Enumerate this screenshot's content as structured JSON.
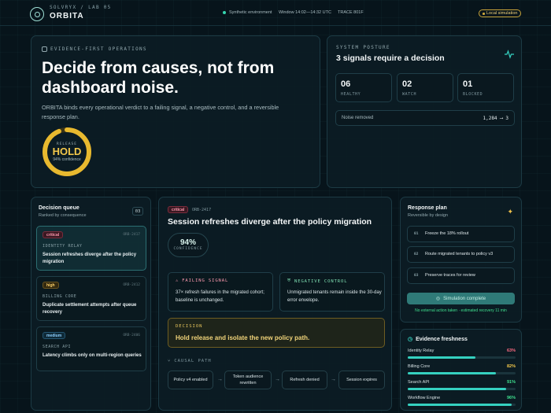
{
  "topbar": {
    "org": "SOLVRYX / LAB 05",
    "app": "ORBITA",
    "environment": "Synthetic environment",
    "window": "Window 14:02—14:32 UTC",
    "trace": "TRACE 801F",
    "simulation": "Local simulation"
  },
  "hero": {
    "kicker": "EVIDENCE-FIRST OPERATIONS",
    "title": "Decide from causes, not from dashboard noise.",
    "description": "ORBITA binds every operational verdict to a failing signal, a negative control, and a reversible response plan.",
    "gauge": {
      "label": "RELEASE",
      "value": "HOLD",
      "confidence": "94% confidence",
      "confidence_fraction": 0.94
    }
  },
  "posture": {
    "kicker": "SYSTEM POSTURE",
    "title": "3 signals require a decision",
    "stats": [
      {
        "value": "06",
        "label": "HEALTHY"
      },
      {
        "value": "02",
        "label": "WATCH"
      },
      {
        "value": "01",
        "label": "BLOCKED"
      }
    ],
    "noise": {
      "label": "Noise removed",
      "value": "1,284 ⟶ 3"
    }
  },
  "queue": {
    "title": "Decision queue",
    "subtitle": "Ranked by consequence",
    "count": "03",
    "items": [
      {
        "severity": "critical",
        "id": "ORB-2417",
        "service": "IDENTITY RELAY",
        "text": "Session refreshes diverge after the policy migration"
      },
      {
        "severity": "high",
        "id": "ORB-2412",
        "service": "BILLING CORE",
        "text": "Duplicate settlement attempts after queue recovery"
      },
      {
        "severity": "medium",
        "id": "ORB-2406",
        "service": "SEARCH API",
        "text": "Latency climbs only on multi-region queries"
      }
    ]
  },
  "detail": {
    "severity": "critical",
    "id": "ORB-2417",
    "title": "Session refreshes diverge after the policy migration",
    "confidence": "94%",
    "confidence_label": "CONFIDENCE",
    "failing_signal": {
      "heading": "FAILING SIGNAL",
      "text": "37× refresh failures in the migrated cohort; baseline is unchanged."
    },
    "negative_control": {
      "heading": "NEGATIVE CONTROL",
      "text": "Unmigrated tenants remain inside the 30-day error envelope."
    },
    "decision": {
      "heading": "DECISION",
      "text": "Hold release and isolate the new policy path."
    },
    "causal_heading": "CAUSAL PATH",
    "causal_path": [
      "Policy v4 enabled",
      "Token audience rewritten",
      "Refresh denied",
      "Session expires"
    ]
  },
  "plan": {
    "title": "Response plan",
    "subtitle": "Reversible by design",
    "steps": [
      {
        "n": "01",
        "text": "Freeze the 18% rollout"
      },
      {
        "n": "02",
        "text": "Route migrated tenants to policy v3"
      },
      {
        "n": "03",
        "text": "Preserve traces for review"
      }
    ],
    "button": "Simulation complete",
    "note": "No external action taken · estimated recovery 11 min"
  },
  "freshness": {
    "title": "Evidence freshness",
    "rows": [
      {
        "label": "Identity Relay",
        "percent": "63%",
        "value": 0.63,
        "color": "#ff6b82"
      },
      {
        "label": "Billing Core",
        "percent": "82%",
        "value": 0.82,
        "color": "#f3c84b"
      },
      {
        "label": "Search API",
        "percent": "91%",
        "value": 0.91,
        "color": "#3fe08f"
      },
      {
        "label": "Workflow Engine",
        "percent": "96%",
        "value": 0.96,
        "color": "#3fe08f"
      }
    ]
  },
  "colors": {
    "accent": "#35d1c0",
    "hold": "#f3c84b",
    "critical": "#ff9bb0",
    "ok": "#3fe08f"
  }
}
